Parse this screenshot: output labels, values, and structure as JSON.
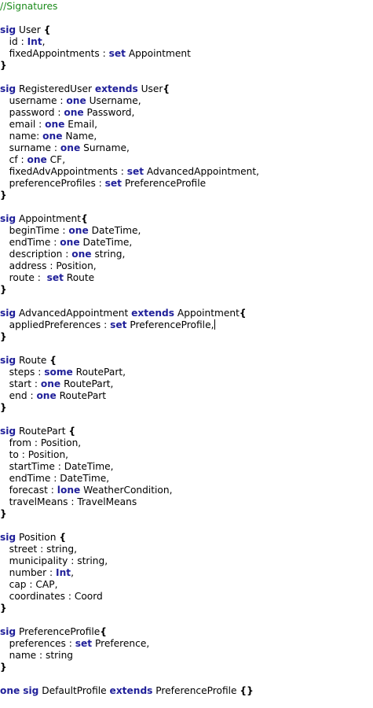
{
  "editor": {
    "colors": {
      "keyword": "#1f1f99",
      "comment": "#1a8a1a",
      "text": "#000000",
      "background": "#ffffff"
    },
    "cursor_line": 27,
    "lines": [
      [
        [
          "c",
          "//Signatures"
        ]
      ],
      [],
      [
        [
          "k",
          "sig"
        ],
        [
          "t",
          " User "
        ],
        [
          "b",
          "{"
        ]
      ],
      [
        [
          "t",
          "   id : "
        ],
        [
          "k",
          "Int"
        ],
        [
          "t",
          ","
        ]
      ],
      [
        [
          "t",
          "   fixedAppointments : "
        ],
        [
          "k",
          "set"
        ],
        [
          "t",
          " Appointment"
        ]
      ],
      [
        [
          "b",
          "}"
        ]
      ],
      [],
      [
        [
          "k",
          "sig"
        ],
        [
          "t",
          " RegisteredUser "
        ],
        [
          "k",
          "extends"
        ],
        [
          "t",
          " User"
        ],
        [
          "b",
          "{"
        ]
      ],
      [
        [
          "t",
          "   username : "
        ],
        [
          "k",
          "one"
        ],
        [
          "t",
          " Username,"
        ]
      ],
      [
        [
          "t",
          "   password : "
        ],
        [
          "k",
          "one"
        ],
        [
          "t",
          " Password,"
        ]
      ],
      [
        [
          "t",
          "   email : "
        ],
        [
          "k",
          "one"
        ],
        [
          "t",
          " Email,"
        ]
      ],
      [
        [
          "t",
          "   name: "
        ],
        [
          "k",
          "one"
        ],
        [
          "t",
          " Name,"
        ]
      ],
      [
        [
          "t",
          "   surname : "
        ],
        [
          "k",
          "one"
        ],
        [
          "t",
          " Surname,"
        ]
      ],
      [
        [
          "t",
          "   cf : "
        ],
        [
          "k",
          "one"
        ],
        [
          "t",
          " CF,"
        ]
      ],
      [
        [
          "t",
          "   fixedAdvAppointments : "
        ],
        [
          "k",
          "set"
        ],
        [
          "t",
          " AdvancedAppointment,"
        ]
      ],
      [
        [
          "t",
          "   preferenceProfiles : "
        ],
        [
          "k",
          "set"
        ],
        [
          "t",
          " PreferenceProfile"
        ]
      ],
      [
        [
          "b",
          "}"
        ]
      ],
      [],
      [
        [
          "k",
          "sig"
        ],
        [
          "t",
          " Appointment"
        ],
        [
          "b",
          "{"
        ]
      ],
      [
        [
          "t",
          "   beginTime : "
        ],
        [
          "k",
          "one"
        ],
        [
          "t",
          " DateTime,"
        ]
      ],
      [
        [
          "t",
          "   endTime : "
        ],
        [
          "k",
          "one"
        ],
        [
          "t",
          " DateTime,"
        ]
      ],
      [
        [
          "t",
          "   description : "
        ],
        [
          "k",
          "one"
        ],
        [
          "t",
          " string,"
        ]
      ],
      [
        [
          "t",
          "   address : Position,"
        ]
      ],
      [
        [
          "t",
          "   route :  "
        ],
        [
          "k",
          "set"
        ],
        [
          "t",
          " Route"
        ]
      ],
      [
        [
          "b",
          "}"
        ]
      ],
      [],
      [
        [
          "k",
          "sig"
        ],
        [
          "t",
          " AdvancedAppointment "
        ],
        [
          "k",
          "extends"
        ],
        [
          "t",
          " Appointment"
        ],
        [
          "b",
          "{"
        ]
      ],
      [
        [
          "t",
          "   appliedPreferences : "
        ],
        [
          "k",
          "set"
        ],
        [
          "t",
          " PreferenceProfile,"
        ]
      ],
      [
        [
          "b",
          "}"
        ]
      ],
      [],
      [
        [
          "k",
          "sig"
        ],
        [
          "t",
          " Route "
        ],
        [
          "b",
          "{"
        ]
      ],
      [
        [
          "t",
          "   steps : "
        ],
        [
          "k",
          "some"
        ],
        [
          "t",
          " RoutePart,"
        ]
      ],
      [
        [
          "t",
          "   start : "
        ],
        [
          "k",
          "one"
        ],
        [
          "t",
          " RoutePart,"
        ]
      ],
      [
        [
          "t",
          "   end : "
        ],
        [
          "k",
          "one"
        ],
        [
          "t",
          " RoutePart"
        ]
      ],
      [
        [
          "b",
          "}"
        ]
      ],
      [],
      [
        [
          "k",
          "sig"
        ],
        [
          "t",
          " RoutePart "
        ],
        [
          "b",
          "{"
        ]
      ],
      [
        [
          "t",
          "   from : Position,"
        ]
      ],
      [
        [
          "t",
          "   to : Position,"
        ]
      ],
      [
        [
          "t",
          "   startTime : DateTime,"
        ]
      ],
      [
        [
          "t",
          "   endTime : DateTime,"
        ]
      ],
      [
        [
          "t",
          "   forecast : "
        ],
        [
          "k",
          "lone"
        ],
        [
          "t",
          " WeatherCondition,"
        ]
      ],
      [
        [
          "t",
          "   travelMeans : TravelMeans"
        ]
      ],
      [
        [
          "b",
          "}"
        ]
      ],
      [],
      [
        [
          "k",
          "sig"
        ],
        [
          "t",
          " Position "
        ],
        [
          "b",
          "{"
        ]
      ],
      [
        [
          "t",
          "   street : string,"
        ]
      ],
      [
        [
          "t",
          "   municipality : string,"
        ]
      ],
      [
        [
          "t",
          "   number : "
        ],
        [
          "k",
          "Int"
        ],
        [
          "t",
          ","
        ]
      ],
      [
        [
          "t",
          "   cap : CAP,"
        ]
      ],
      [
        [
          "t",
          "   coordinates : Coord"
        ]
      ],
      [
        [
          "b",
          "}"
        ]
      ],
      [],
      [
        [
          "k",
          "sig"
        ],
        [
          "t",
          " PreferenceProfile"
        ],
        [
          "b",
          "{"
        ]
      ],
      [
        [
          "t",
          "   preferences : "
        ],
        [
          "k",
          "set"
        ],
        [
          "t",
          " Preference,"
        ]
      ],
      [
        [
          "t",
          "   name : string"
        ]
      ],
      [
        [
          "b",
          "}"
        ]
      ],
      [],
      [
        [
          "k",
          "one"
        ],
        [
          "t",
          " "
        ],
        [
          "k",
          "sig"
        ],
        [
          "t",
          " DefaultProfile "
        ],
        [
          "k",
          "extends"
        ],
        [
          "t",
          " PreferenceProfile "
        ],
        [
          "b",
          "{}"
        ]
      ]
    ]
  }
}
